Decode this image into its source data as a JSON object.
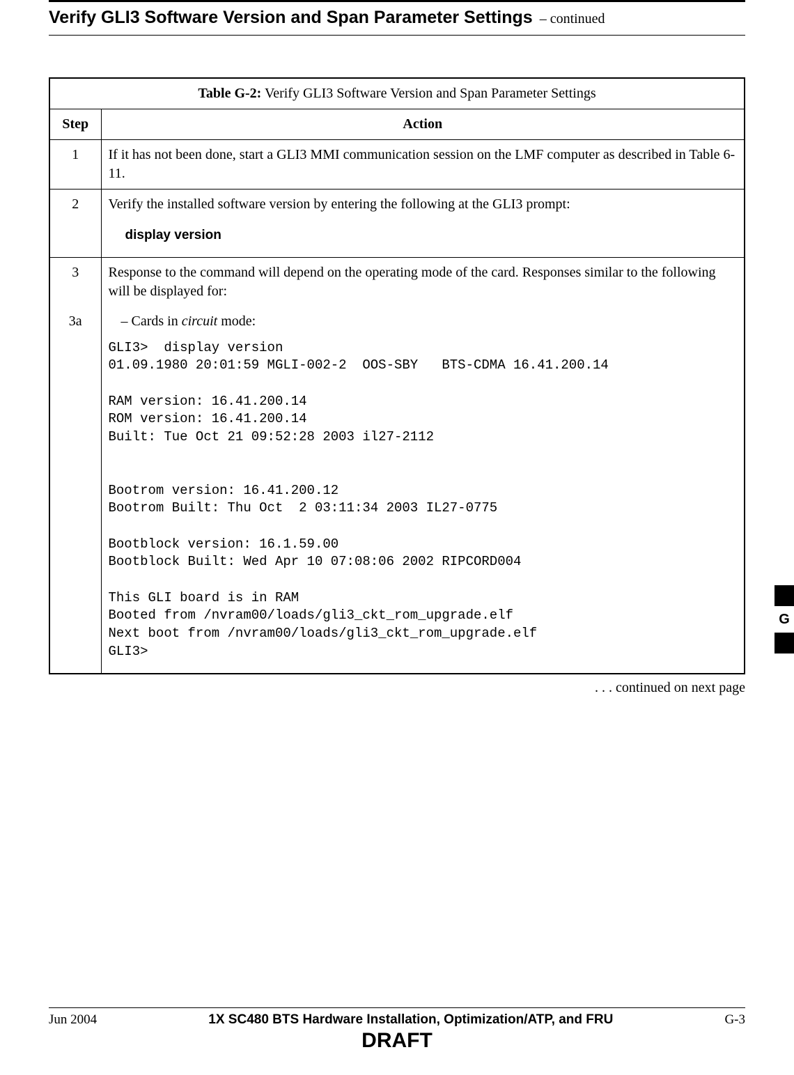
{
  "header": {
    "title": "Verify GLI3 Software Version and Span Parameter Settings",
    "continued": " – continued"
  },
  "table": {
    "caption_label": "Table G-2:",
    "caption_text": " Verify GLI3 Software Version and Span Parameter Settings",
    "col_step": "Step",
    "col_action": "Action",
    "rows": {
      "r1": {
        "step": "1",
        "action": "If it has not been done, start a GLI3 MMI communication session on the LMF computer as described in Table 6-11."
      },
      "r2": {
        "step": "2",
        "action_intro": "Verify the installed software version by entering the following at the GLI3 prompt:",
        "command": "display version"
      },
      "r3": {
        "step": "3",
        "action": "Response to the command will depend on the operating mode of the card. Responses similar to the following will be displayed for:"
      },
      "r3a": {
        "step": "3a",
        "intro_prefix": "– Cards in ",
        "intro_italic": "circuit",
        "intro_suffix": " mode:",
        "terminal": "GLI3>  display version\n01.09.1980 20:01:59 MGLI-002-2  OOS-SBY   BTS-CDMA 16.41.200.14\n\nRAM version: 16.41.200.14\nROM version: 16.41.200.14\nBuilt: Tue Oct 21 09:52:28 2003 il27-2112\n\n\nBootrom version: 16.41.200.12\nBootrom Built: Thu Oct  2 03:11:34 2003 IL27-0775\n\nBootblock version: 16.1.59.00\nBootblock Built: Wed Apr 10 07:08:06 2002 RIPCORD004\n\nThis GLI board is in RAM\nBooted from /nvram00/loads/gli3_ckt_rom_upgrade.elf\nNext boot from /nvram00/loads/gli3_ckt_rom_upgrade.elf\nGLI3>"
      }
    },
    "continued_note": ". . . continued on next page"
  },
  "side_tab": {
    "label": "G"
  },
  "footer": {
    "date": "Jun 2004",
    "title": "1X SC480 BTS Hardware Installation, Optimization/ATP, and FRU",
    "page": "G-3",
    "draft": "DRAFT"
  }
}
